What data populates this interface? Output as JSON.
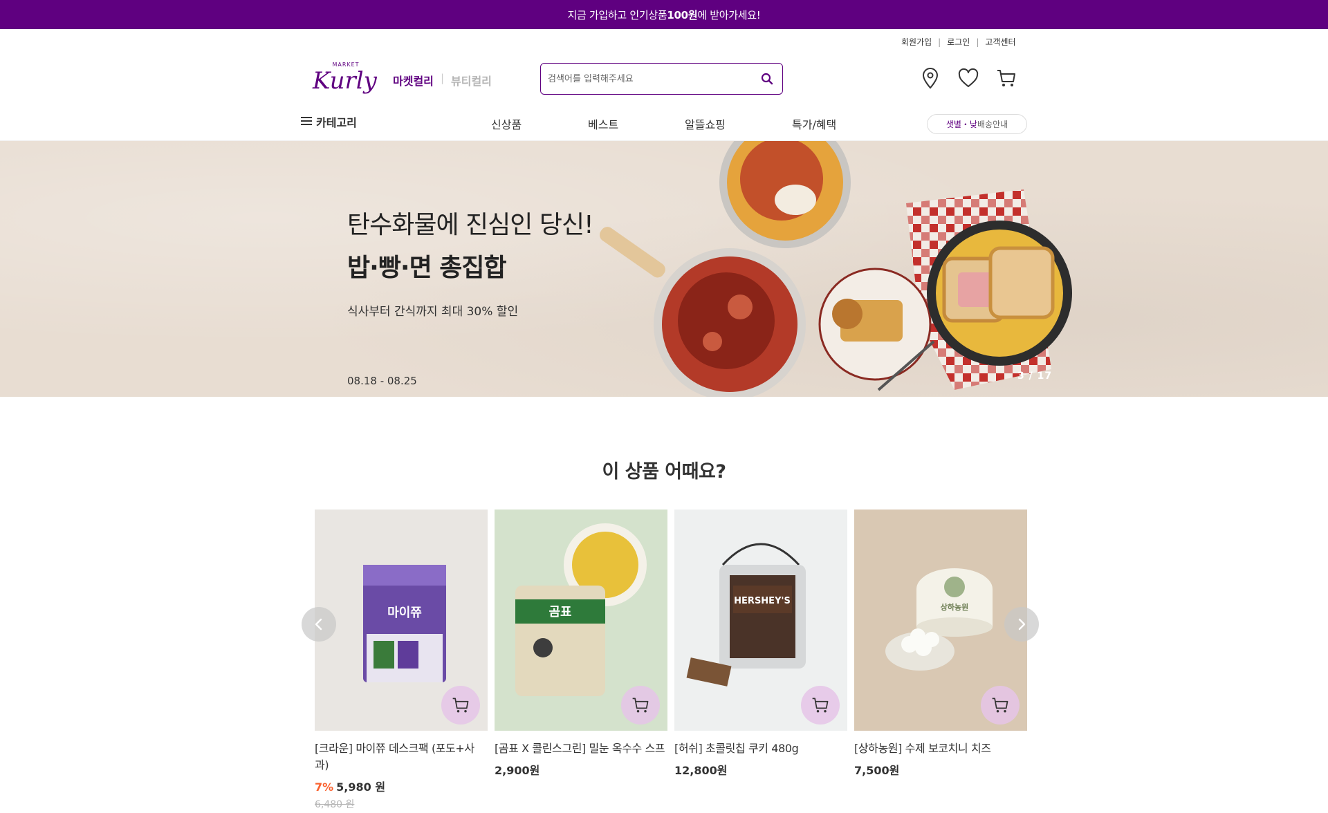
{
  "promo": {
    "pre": "지금 가입하고 인기상품 ",
    "bold": "100원",
    "post": "에 받아가세요!"
  },
  "user_links": {
    "signup": "회원가입",
    "login": "로그인",
    "support": "고객센터",
    "sep": "|"
  },
  "logo": {
    "top": "MARKET",
    "main": "Kurly"
  },
  "brand_tabs": {
    "market": "마켓컬리",
    "sep": "|",
    "beauty": "뷰티컬리"
  },
  "search": {
    "placeholder": "검색어를 입력해주세요",
    "icon": "search-icon"
  },
  "header_icons": [
    "location-icon",
    "heart-icon",
    "cart-icon"
  ],
  "nav": {
    "category": "카테고리",
    "items": [
      "신상품",
      "베스트",
      "알뜰쇼핑",
      "특가/혜택"
    ],
    "delivery_purple": "샛별・낮",
    "delivery_rest": " 배송안내"
  },
  "banner": {
    "line1": "탄수화물에 진심인 당신!",
    "line2": "밥·빵·면 총집합",
    "line3": "식사부터 간식까지 최대 30% 할인",
    "date": "08.18 - 08.25",
    "counter": "3 / 17"
  },
  "section": {
    "title": "이 상품 어때요?"
  },
  "products": [
    {
      "name": "[크라운] 마이쮸 데스크팩 (포도+사과)",
      "discount": "7%",
      "price": "5,980 원",
      "original": "6,480 원",
      "bg": "#e9e6e2",
      "label": "마이쮸"
    },
    {
      "name": "[곰표 X 콜린스그린] 밀눈 옥수수 스프",
      "price": "2,900원",
      "bg": "#d4e2cc",
      "label": "곰표"
    },
    {
      "name": "[허쉬] 초콜릿칩 쿠키 480g",
      "price": "12,800원",
      "bg": "#eef0f0",
      "label": "HERSHEY'S"
    },
    {
      "name": "[상하농원] 수제 보코치니 치즈",
      "price": "7,500원",
      "bg": "#d9c8b3",
      "label": "상하농원"
    }
  ],
  "colors": {
    "brand": "#5f0080",
    "discount": "#fa622f"
  }
}
